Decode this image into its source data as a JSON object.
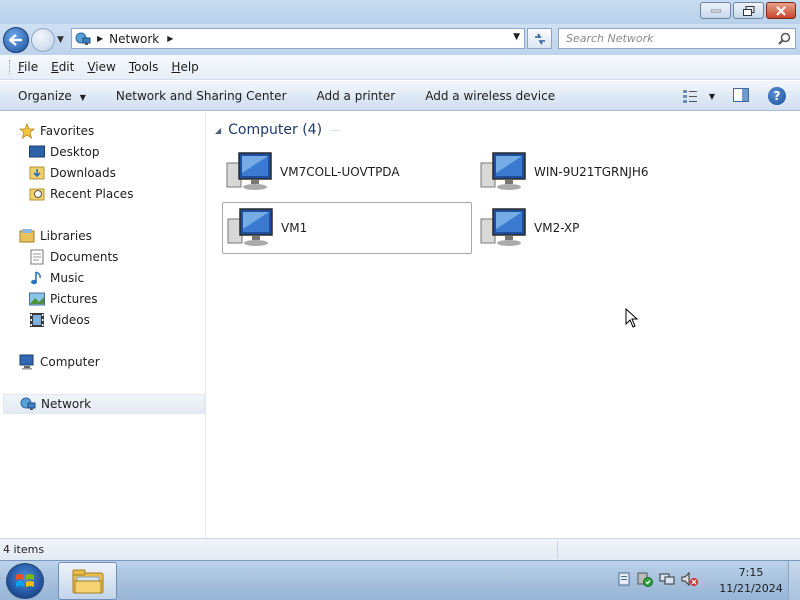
{
  "window": {
    "controls": [
      "minimize",
      "restore",
      "close"
    ]
  },
  "address_bar": {
    "breadcrumb": "Network",
    "search_placeholder": "Search Network"
  },
  "menu": {
    "items": [
      {
        "label": "File"
      },
      {
        "label": "Edit"
      },
      {
        "label": "View"
      },
      {
        "label": "Tools"
      },
      {
        "label": "Help"
      }
    ]
  },
  "command_bar": {
    "organize": "Organize",
    "network_center": "Network and Sharing Center",
    "add_printer": "Add a printer",
    "add_wireless": "Add a wireless device"
  },
  "nav": {
    "favorites": "Favorites",
    "desktop": "Desktop",
    "downloads": "Downloads",
    "recent": "Recent Places",
    "libraries": "Libraries",
    "documents": "Documents",
    "music": "Music",
    "pictures": "Pictures",
    "videos": "Videos",
    "computer": "Computer",
    "network": "Network",
    "selected": "Network"
  },
  "content": {
    "group_title": "Computer (4)",
    "computers": [
      {
        "name": "VM7COLL-UOVTPDA"
      },
      {
        "name": "WIN-9U21TGRNJH6"
      },
      {
        "name": "VM1",
        "selected": true
      },
      {
        "name": "VM2-XP"
      }
    ]
  },
  "status": {
    "text": "4 items"
  },
  "taskbar": {
    "time": "7:15",
    "date": "11/21/2024",
    "pinned": [
      "windows-explorer"
    ]
  },
  "colors": {
    "group_title": "#1e3b6e",
    "selection_border": "#a9a9a9"
  }
}
